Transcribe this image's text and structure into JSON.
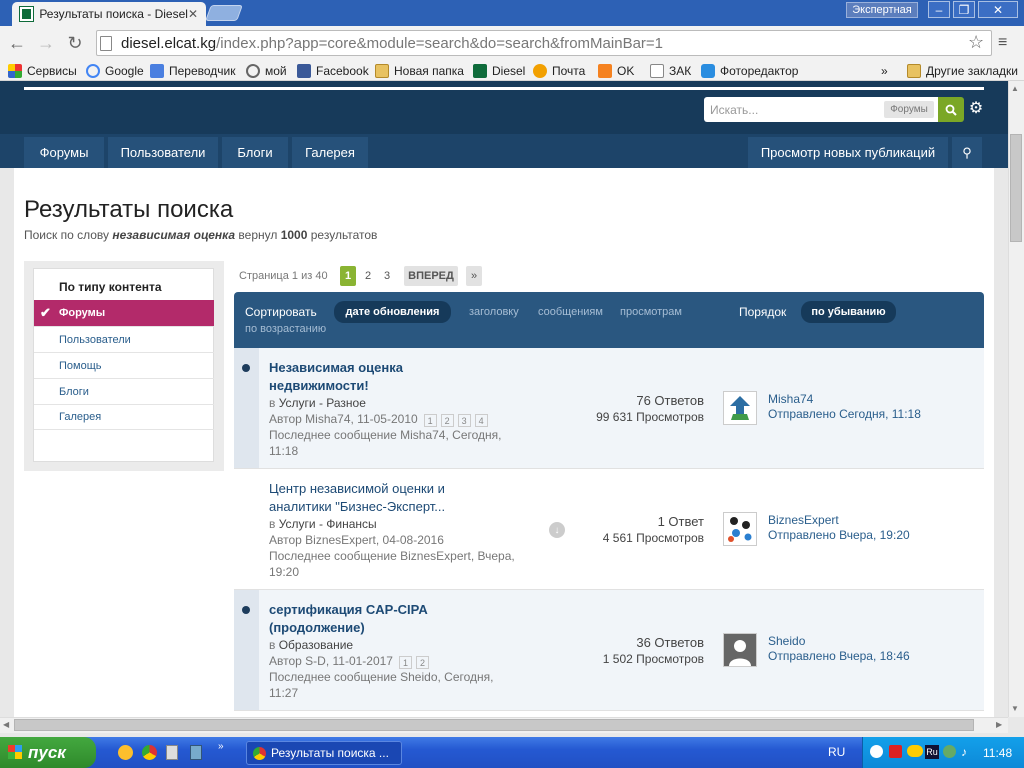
{
  "browser": {
    "tab_title": "Результаты поиска - Diesel",
    "profile_label": "Экспертная",
    "url_host": "diesel.elcat.kg",
    "url_path": "/index.php?app=core&module=search&do=search&fromMainBar=1",
    "bookmarks": [
      "Сервисы",
      "Google",
      "Переводчик",
      "мой",
      "Facebook",
      "Новая папка",
      "Diesel",
      "Почта",
      "OK",
      "ЗАК",
      "Фоторедактор"
    ],
    "more_bookmarks": "»",
    "other_bookmarks": "Другие закладки"
  },
  "header": {
    "search_placeholder": "Искать...",
    "search_scope": "Форумы"
  },
  "nav": {
    "items": [
      "Форумы",
      "Пользователи",
      "Блоги",
      "Галерея"
    ],
    "new_content": "Просмотр новых публикаций"
  },
  "page": {
    "title": "Результаты поиска",
    "subtitle_prefix": "Поиск по слову",
    "query": "независимая оценка",
    "subtitle_mid": "вернул",
    "count": "1000",
    "subtitle_suffix": "результатов"
  },
  "sidebar": {
    "heading": "По типу контента",
    "active": "Форумы",
    "items": [
      "Пользователи",
      "Помощь",
      "Блоги",
      "Галерея"
    ]
  },
  "pagination": {
    "label": "Страница 1 из 40",
    "pages": [
      "1",
      "2",
      "3"
    ],
    "next": "ВПЕРЕД",
    "last": "»"
  },
  "sort": {
    "label": "Сортировать",
    "active": "дате обновления",
    "options": [
      "заголовку",
      "сообщениям",
      "просмотрам"
    ],
    "order_label": "Порядок",
    "order_active": "по убыванию",
    "order_other": "по возрастанию"
  },
  "results": [
    {
      "title": "Независимая оценка недвижимости!",
      "bold": true,
      "prefix": "в",
      "location": "Услуги - Разное",
      "author": "Автор Misha74, 11-05-2010",
      "pages": [
        "1",
        "2",
        "3",
        "4"
      ],
      "last": "Последнее сообщение Misha74, Сегодня, 11:18",
      "replies": "76 Ответов",
      "views": "99 631 Просмотров",
      "user": "Misha74",
      "sent": "Отправлено Сегодня, 11:18"
    },
    {
      "title": "Центр независимой оценки и аналитики \"Бизнес-Эксперт...",
      "bold": false,
      "prefix": "в",
      "location": "Услуги - Финансы",
      "author": "Автор BiznesExpert, 04-08-2016",
      "pages": [],
      "last": "Последнее сообщение BiznesExpert, Вчера, 19:20",
      "replies": "1 Ответ",
      "views": "4 561 Просмотров",
      "user": "BiznesExpert",
      "sent": "Отправлено Вчера, 19:20"
    },
    {
      "title": "сертификация CAP-CIPA (продолжение)",
      "bold": true,
      "prefix": "в",
      "location": "Образование",
      "author": "Автор S-D, 11-01-2017",
      "pages": [
        "1",
        "2"
      ],
      "last": "Последнее сообщение Sheido, Сегодня, 11:27",
      "replies": "36 Ответов",
      "views": "1 502 Просмотров",
      "user": "Sheido",
      "sent": "Отправлено Вчера, 18:46"
    }
  ],
  "taskbar": {
    "start": "пуск",
    "task": "Результаты поиска ...",
    "lang": "RU",
    "clock": "11:48"
  }
}
